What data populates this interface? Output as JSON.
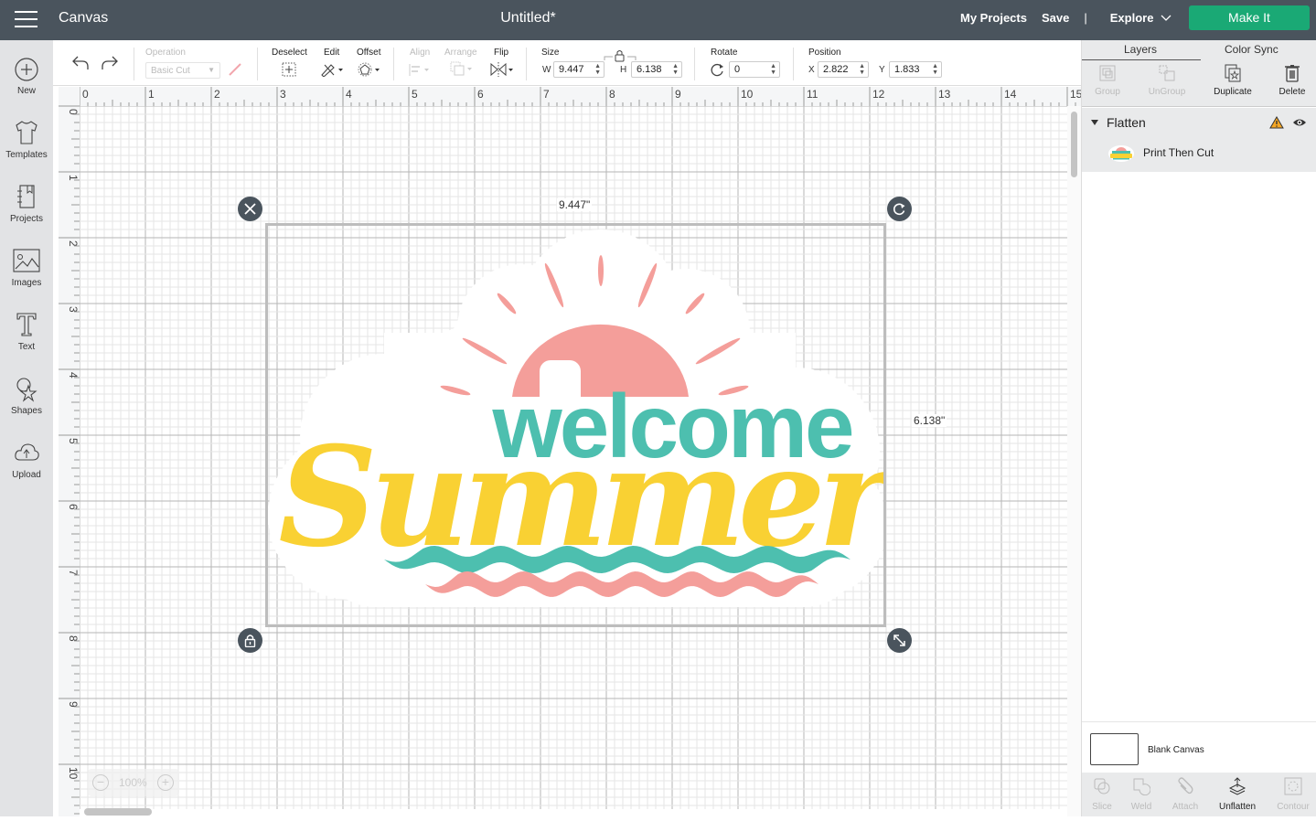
{
  "topbar": {
    "app_title": "Canvas",
    "document_title": "Untitled*",
    "links": {
      "my_projects": "My Projects",
      "save": "Save",
      "separator": "|",
      "explore": "Explore"
    },
    "make_it": "Make It",
    "make_it_color": "#1aa975"
  },
  "sidebar": {
    "items": [
      {
        "label": "New",
        "icon": "plus-circle-icon"
      },
      {
        "label": "Templates",
        "icon": "tshirt-icon"
      },
      {
        "label": "Projects",
        "icon": "notebook-icon"
      },
      {
        "label": "Images",
        "icon": "image-icon"
      },
      {
        "label": "Text",
        "icon": "text-t-icon"
      },
      {
        "label": "Shapes",
        "icon": "shapes-icon"
      },
      {
        "label": "Upload",
        "icon": "cloud-upload-icon"
      }
    ]
  },
  "toolbar": {
    "operation_label": "Operation",
    "operation_value": "Basic Cut",
    "deselect": "Deselect",
    "edit": "Edit",
    "offset": "Offset",
    "align": "Align",
    "arrange": "Arrange",
    "flip": "Flip",
    "size_label": "Size",
    "w_label": "W",
    "w_value": "9.447",
    "h_label": "H",
    "h_value": "6.138",
    "rotate_label": "Rotate",
    "rotate_value": "0",
    "position_label": "Position",
    "x_label": "X",
    "x_value": "2.822",
    "y_label": "Y",
    "y_value": "1.833"
  },
  "rulers": {
    "top": [
      "0",
      "1",
      "2",
      "3",
      "4",
      "5",
      "6",
      "7",
      "8",
      "9",
      "10",
      "11",
      "12",
      "13",
      "14",
      "15"
    ],
    "left": [
      "0",
      "1",
      "2",
      "3",
      "4",
      "5",
      "6",
      "7",
      "8",
      "9",
      "10"
    ]
  },
  "canvas": {
    "width_label": "9.447\"",
    "height_label": "6.138\"",
    "zoom_level": "100%",
    "design": {
      "line1": "welcome",
      "line2": "Summer",
      "colors": {
        "teal": "#4dbfaf",
        "yellow": "#f9d133",
        "coral": "#f49e9a"
      }
    }
  },
  "layers_panel": {
    "tabs": [
      "Layers",
      "Color Sync"
    ],
    "active_tab": "Layers",
    "tools": [
      {
        "label": "Group",
        "enabled": false
      },
      {
        "label": "UnGroup",
        "enabled": false
      },
      {
        "label": "Duplicate",
        "enabled": true
      },
      {
        "label": "Delete",
        "enabled": true
      }
    ],
    "group": {
      "name": "Flatten",
      "warning": true,
      "visible": true
    },
    "items": [
      {
        "name": "Print Then Cut"
      }
    ],
    "blank_canvas": "Blank Canvas",
    "bottom_tools": [
      {
        "label": "Slice",
        "enabled": false
      },
      {
        "label": "Weld",
        "enabled": false
      },
      {
        "label": "Attach",
        "enabled": false
      },
      {
        "label": "Unflatten",
        "enabled": true
      },
      {
        "label": "Contour",
        "enabled": false
      }
    ]
  }
}
